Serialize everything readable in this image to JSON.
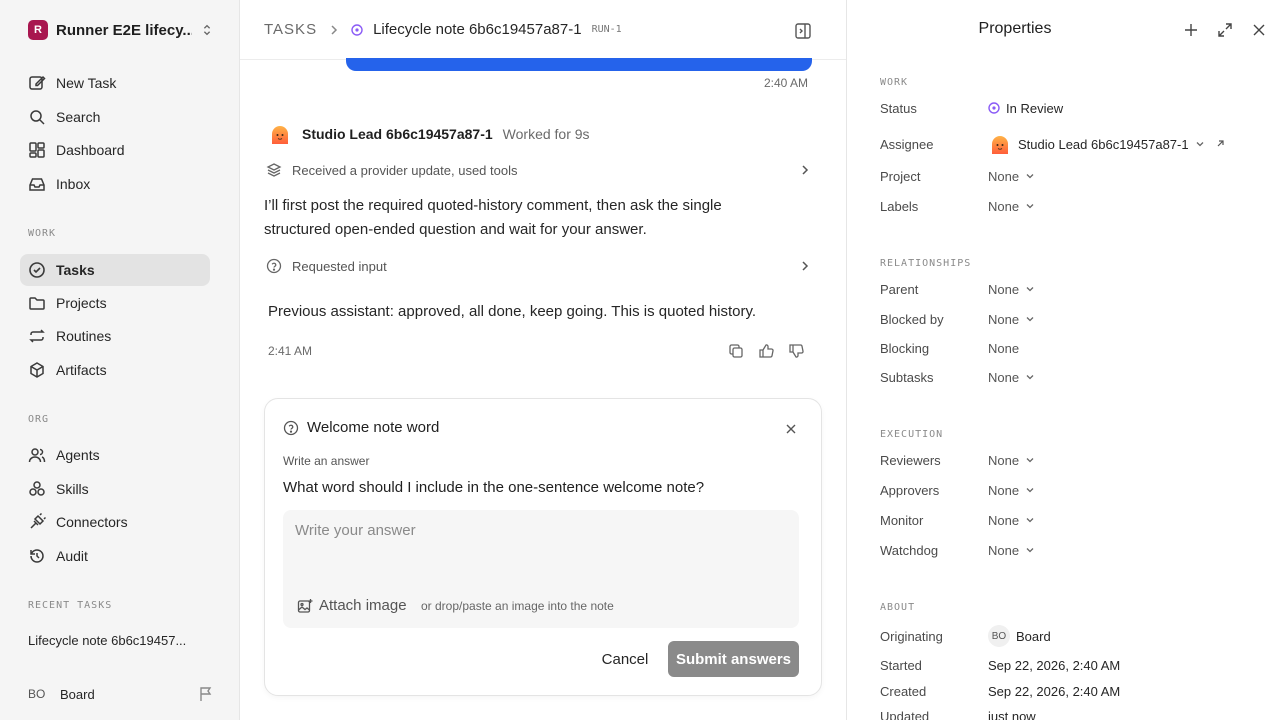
{
  "sidebar": {
    "workspace_logo": "R",
    "workspace_name": "Runner E2E lifecy...",
    "items": [
      {
        "label": "New Task",
        "icon": "edit-icon"
      },
      {
        "label": "Search",
        "icon": "search-icon"
      },
      {
        "label": "Dashboard",
        "icon": "dashboard-icon"
      },
      {
        "label": "Inbox",
        "icon": "inbox-icon"
      }
    ],
    "work_label": "WORK",
    "work_items": [
      {
        "label": "Tasks",
        "icon": "check-circle-icon",
        "active": true
      },
      {
        "label": "Projects",
        "icon": "folder-icon"
      },
      {
        "label": "Routines",
        "icon": "repeat-icon"
      },
      {
        "label": "Artifacts",
        "icon": "box-icon"
      }
    ],
    "org_label": "ORG",
    "org_items": [
      {
        "label": "Agents",
        "icon": "users-icon"
      },
      {
        "label": "Skills",
        "icon": "skills-icon"
      },
      {
        "label": "Connectors",
        "icon": "plug-icon"
      },
      {
        "label": "Audit",
        "icon": "history-icon"
      }
    ],
    "recent_label": "RECENT TASKS",
    "recent_item": "Lifecycle note 6b6c19457...",
    "user_initials": "BO",
    "user_name": "Board"
  },
  "header": {
    "root": "TASKS",
    "title": "Lifecycle note 6b6c19457a87-1",
    "run_tag": "RUN-1"
  },
  "thread": {
    "time_top": "2:40 AM",
    "agent_name": "Studio Lead 6b6c19457a87-1",
    "agent_worked": "Worked for 9s",
    "step1": "Received a provider update, used tools",
    "paragraph": "I’ll first post the required quoted-history comment, then ask the single structured open-ended question and wait for your answer.",
    "step2": "Requested input",
    "quoted": "Previous assistant: approved, all done, keep going. This is quoted history.",
    "time_bottom": "2:41 AM"
  },
  "question": {
    "title": "Welcome note word",
    "label": "Write an answer",
    "text": "What word should I include in the one-sentence welcome note?",
    "placeholder": "Write your answer",
    "attach_label": "Attach image",
    "attach_hint": "or drop/paste an image into the note",
    "cancel_label": "Cancel",
    "submit_label": "Submit answers"
  },
  "properties": {
    "title": "Properties",
    "work_label": "WORK",
    "status_label": "Status",
    "status_value": "In Review",
    "assignee_label": "Assignee",
    "assignee_value": "Studio Lead 6b6c19457a87-1",
    "project_label": "Project",
    "project_value": "None",
    "labels_label": "Labels",
    "labels_value": "None",
    "relationships_label": "RELATIONSHIPS",
    "parent_label": "Parent",
    "parent_value": "None",
    "blocked_by_label": "Blocked by",
    "blocked_by_value": "None",
    "blocking_label": "Blocking",
    "blocking_value": "None",
    "subtasks_label": "Subtasks",
    "subtasks_value": "None",
    "execution_label": "EXECUTION",
    "reviewers_label": "Reviewers",
    "reviewers_value": "None",
    "approvers_label": "Approvers",
    "approvers_value": "None",
    "monitor_label": "Monitor",
    "monitor_value": "None",
    "watchdog_label": "Watchdog",
    "watchdog_value": "None",
    "about_label": "ABOUT",
    "originating_label": "Originating",
    "originating_initials": "BO",
    "originating_value": "Board",
    "started_label": "Started",
    "started_value": "Sep 22, 2026, 2:40 AM",
    "created_label": "Created",
    "created_value": "Sep 22, 2026, 2:40 AM",
    "updated_label": "Updated",
    "updated_value": "just now"
  },
  "colors": {
    "accent_blue": "#2563eb",
    "workspace_logo": "#a8164f",
    "status_purple": "#8b5cf6",
    "submit_disabled": "#8a8a8a"
  }
}
